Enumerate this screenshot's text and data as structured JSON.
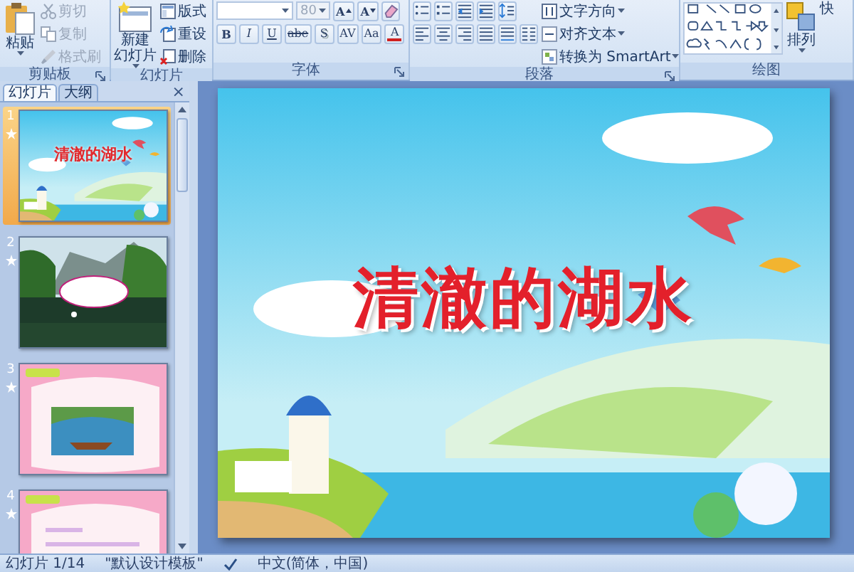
{
  "ribbon": {
    "groups": [
      {
        "label": "剪贴板",
        "launcher": true,
        "sections": [
          {
            "kind": "big",
            "button": {
              "kind": "paste",
              "lines": [
                "粘贴"
              ]
            }
          },
          {
            "kind": "rows",
            "rows": [
              {
                "items": [
                  {
                    "kind": "cut",
                    "label": "剪切",
                    "disabled": true
                  }
                ]
              },
              {
                "items": [
                  {
                    "kind": "copy",
                    "label": "复制",
                    "disabled": true
                  }
                ]
              },
              {
                "items": [
                  {
                    "kind": "painter",
                    "label": "格式刷",
                    "disabled": true
                  }
                ]
              }
            ]
          }
        ]
      },
      {
        "label": "幻灯片",
        "launcher": false,
        "sections": [
          {
            "kind": "big",
            "button": {
              "kind": "newslide",
              "lines": [
                "新建",
                "幻灯片"
              ]
            }
          },
          {
            "kind": "rows",
            "rows": [
              {
                "items": [
                  {
                    "kind": "layout",
                    "label": "版式"
                  }
                ]
              },
              {
                "items": [
                  {
                    "kind": "reset",
                    "label": "重设"
                  }
                ]
              },
              {
                "items": [
                  {
                    "kind": "delete",
                    "label": "删除"
                  }
                ]
              }
            ]
          }
        ]
      },
      {
        "label": "字体",
        "launcher": true,
        "sections": [
          {
            "kind": "rows",
            "rows": [
              {
                "items": [
                  {
                    "kind": "fontname"
                  },
                  {
                    "kind": "fontsize",
                    "value": "80",
                    "disabled": true
                  },
                  {
                    "kind": "grow",
                    "text": "A"
                  },
                  {
                    "kind": "shrink",
                    "text": "A"
                  },
                  {
                    "kind": "clear"
                  }
                ]
              },
              {
                "items": [
                  {
                    "kind": "bold",
                    "text": "B"
                  },
                  {
                    "kind": "italic",
                    "text": "I"
                  },
                  {
                    "kind": "underline",
                    "text": "U"
                  },
                  {
                    "kind": "strike",
                    "text": "abe"
                  },
                  {
                    "kind": "shadow",
                    "text": "S"
                  },
                  {
                    "kind": "spacing",
                    "text": "AV"
                  },
                  {
                    "kind": "case",
                    "text": "Aa"
                  },
                  {
                    "kind": "color",
                    "text": "A"
                  }
                ]
              }
            ]
          }
        ]
      },
      {
        "label": "段落",
        "launcher": true,
        "sections": [
          {
            "kind": "rows",
            "rows": [
              {
                "items": [
                  {
                    "kind": "bullets"
                  },
                  {
                    "kind": "numbering"
                  },
                  {
                    "kind": "outdent"
                  },
                  {
                    "kind": "indent"
                  },
                  {
                    "kind": "linespacing"
                  }
                ]
              },
              {
                "items": [
                  {
                    "kind": "alignleft"
                  },
                  {
                    "kind": "center"
                  },
                  {
                    "kind": "alignright"
                  },
                  {
                    "kind": "justify"
                  },
                  {
                    "kind": "distribute"
                  },
                  {
                    "kind": "columns"
                  }
                ]
              }
            ]
          },
          {
            "kind": "rows",
            "rows": [
              {
                "items": [
                  {
                    "kind": "textdir",
                    "label": "文字方向"
                  }
                ]
              },
              {
                "items": [
                  {
                    "kind": "aligntext",
                    "label": "对齐文本"
                  }
                ]
              },
              {
                "items": [
                  {
                    "kind": "smartart",
                    "label": "转换为 SmartArt"
                  }
                ]
              }
            ]
          }
        ]
      },
      {
        "label": "绘图",
        "launcher": false,
        "sections": [
          {
            "kind": "gallery"
          },
          {
            "kind": "big",
            "button": {
              "kind": "arrange",
              "lines": [
                "排列"
              ]
            }
          },
          {
            "kind": "big",
            "button": {
              "kind": "plain",
              "lines": [
                "快"
              ]
            }
          }
        ]
      }
    ]
  },
  "pane": {
    "tabs": [
      {
        "label": "幻灯片",
        "selected": true
      },
      {
        "label": "大纲",
        "selected": false
      }
    ],
    "close": "×",
    "slides": [
      {
        "number": "1",
        "title": "清澈的湖水",
        "selected": true,
        "animated": true
      },
      {
        "number": "2",
        "selected": false,
        "animated": true
      },
      {
        "number": "3",
        "selected": false,
        "animated": true
      },
      {
        "number": "4",
        "selected": false,
        "animated": true
      }
    ]
  },
  "slide": {
    "title": "清澈的湖水"
  },
  "status_bar": {
    "slide": "幻灯片 1/14",
    "theme": "\"默认设计模板\"",
    "language": "中文(简体，中国)"
  }
}
